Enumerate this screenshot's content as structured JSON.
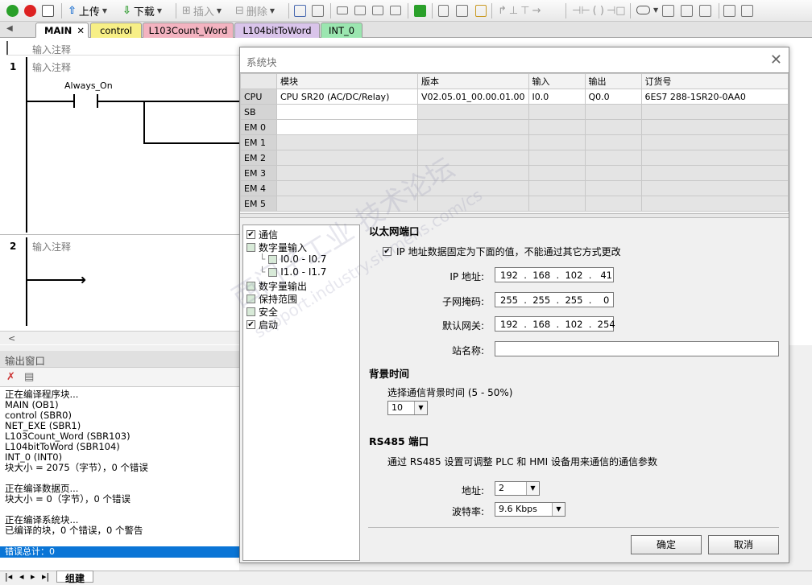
{
  "toolbar": {
    "upload": "上传",
    "download": "下载",
    "insert": "插入",
    "delete": "删除"
  },
  "tabs": [
    "MAIN",
    "control",
    "L103Count_Word",
    "L104bitToWord",
    "INT_0"
  ],
  "ladder": {
    "header_comment": "输入注释",
    "rungs": [
      {
        "num": "1",
        "comment": "输入注释",
        "contact": "Always_On"
      },
      {
        "num": "2",
        "comment": "输入注释"
      }
    ]
  },
  "output": {
    "title": "输出窗口",
    "lines": [
      "正在编译程序块...",
      "MAIN (OB1)",
      "control (SBR0)",
      "NET_EXE (SBR1)",
      "L103Count_Word (SBR103)",
      "L104bitToWord (SBR104)",
      "INT_0 (INT0)",
      "块大小 = 2075（字节），0 个错误",
      "",
      "正在编译数据页...",
      "块大小 = 0（字节），0 个错误",
      "",
      "正在编译系统块...",
      "已编译的块，0 个错误，0 个警告"
    ],
    "error_total": "错误总计：0"
  },
  "bottom": {
    "tab": "组建"
  },
  "dialog": {
    "title": "系统块",
    "columns": [
      "模块",
      "版本",
      "输入",
      "输出",
      "订货号"
    ],
    "rows": [
      {
        "slot": "CPU",
        "module": "CPU SR20 (AC/DC/Relay)",
        "version": "V02.05.01_00.00.01.00",
        "input": "I0.0",
        "output": "Q0.0",
        "order": "6ES7 288-1SR20-0AA0"
      },
      {
        "slot": "SB",
        "module": "",
        "version": "",
        "input": "",
        "output": "",
        "order": ""
      },
      {
        "slot": "EM 0",
        "module": "",
        "version": "",
        "input": "",
        "output": "",
        "order": ""
      },
      {
        "slot": "EM 1",
        "module": "",
        "version": "",
        "input": "",
        "output": "",
        "order": ""
      },
      {
        "slot": "EM 2",
        "module": "",
        "version": "",
        "input": "",
        "output": "",
        "order": ""
      },
      {
        "slot": "EM 3",
        "module": "",
        "version": "",
        "input": "",
        "output": "",
        "order": ""
      },
      {
        "slot": "EM 4",
        "module": "",
        "version": "",
        "input": "",
        "output": "",
        "order": ""
      },
      {
        "slot": "EM 5",
        "module": "",
        "version": "",
        "input": "",
        "output": "",
        "order": ""
      }
    ],
    "tree": {
      "comm": "通信",
      "digital_in": "数字量输入",
      "di_0": "I0.0 - I0.7",
      "di_1": "I1.0 - I1.7",
      "digital_out": "数字量输出",
      "retentive": "保持范围",
      "security": "安全",
      "startup": "启动"
    },
    "ethernet": {
      "header": "以太网端口",
      "fixed_ip_label": "IP 地址数据固定为下面的值，不能通过其它方式更改",
      "ip_label": "IP 地址:",
      "ip": "192  .  168  .  102  .   41",
      "mask_label": "子网掩码:",
      "mask": "255  .  255  .  255  .    0",
      "gateway_label": "默认网关:",
      "gateway": "192  .  168  .  102  .  254",
      "station_label": "站名称:",
      "station": ""
    },
    "background": {
      "header": "背景时间",
      "label": "选择通信背景时间 (5 - 50%)",
      "value": "10"
    },
    "rs485": {
      "header": "RS485 端口",
      "desc": "通过 RS485 设置可调整 PLC 和 HMI 设备用来通信的通信参数",
      "addr_label": "地址:",
      "addr": "2",
      "baud_label": "波特率:",
      "baud": "9.6 Kbps"
    },
    "ok": "确定",
    "cancel": "取消"
  },
  "watermark": {
    "cn": "西门子工业  技术论坛",
    "url": "support.industry.siemens.com/cs"
  }
}
